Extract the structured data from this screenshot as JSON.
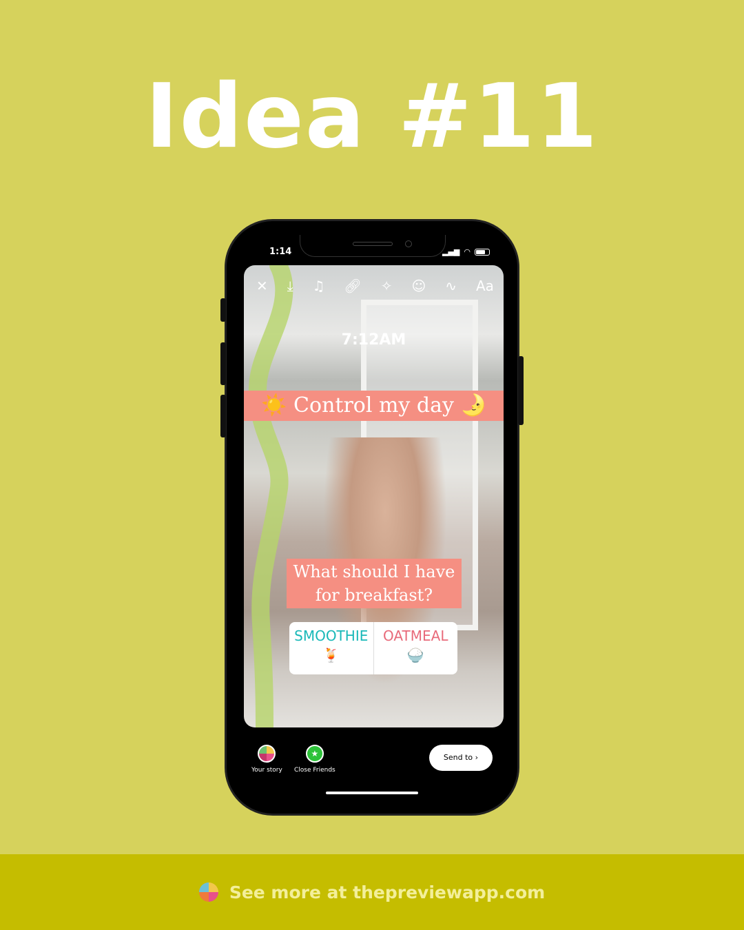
{
  "heading": "Idea #11",
  "status_bar": {
    "time": "1:14"
  },
  "toolbar": {
    "icons": [
      "close-icon",
      "download-icon",
      "music-icon",
      "link-icon",
      "effects-icon",
      "sticker-icon",
      "draw-icon",
      "text-icon"
    ],
    "text_label": "Aa"
  },
  "story": {
    "time_text": "7:12AM",
    "banner_text": "Control my day",
    "banner_left_emoji": "☀️",
    "banner_right_emoji": "🌛",
    "question": "What should I have for breakfast?",
    "poll": [
      {
        "label": "SMOOTHIE",
        "emoji": "🍹"
      },
      {
        "label": "OATMEAL",
        "emoji": "🍚"
      }
    ],
    "accent": "#f58f82"
  },
  "share": {
    "your_story": "Your story",
    "close_friends": "Close Friends",
    "send_to": "Send to"
  },
  "footer": {
    "text": "See more at thepreviewapp.com"
  },
  "colors": {
    "background": "#d6d25c",
    "footer": "#c5bd00"
  }
}
